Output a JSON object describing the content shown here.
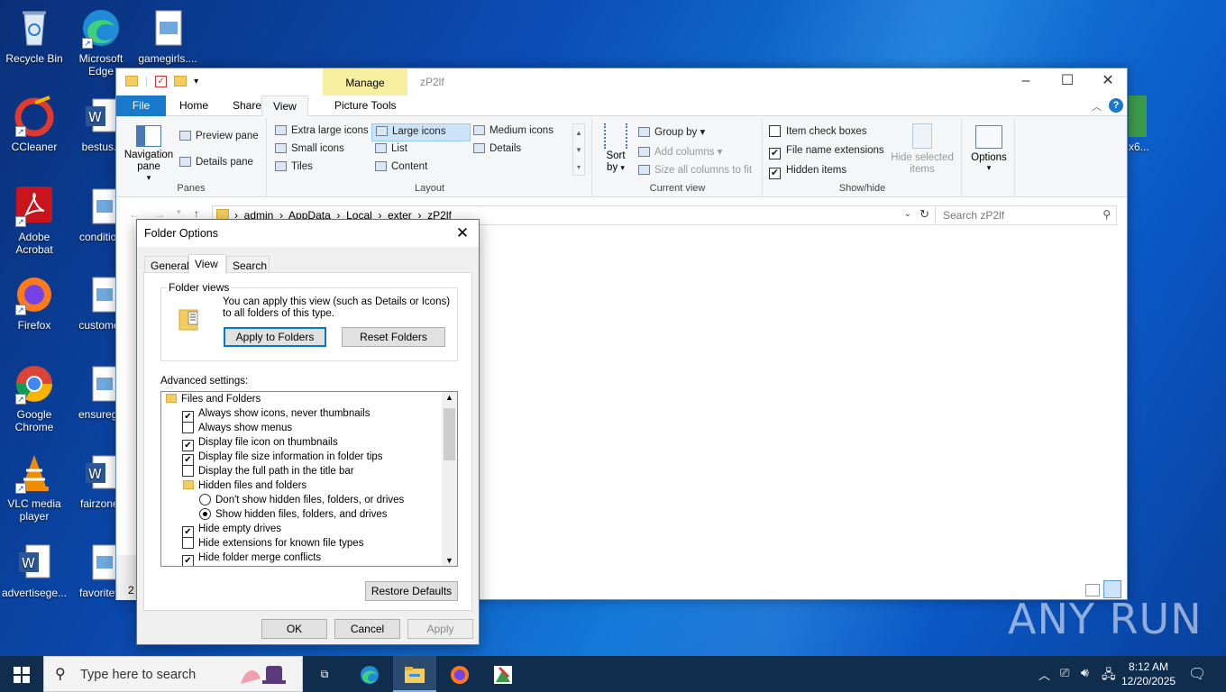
{
  "desktop": {
    "icons": [
      {
        "label": "Recycle Bin"
      },
      {
        "label": "Microsoft Edge"
      },
      {
        "label": "gamegirls...."
      },
      {
        "label": "CCleaner"
      },
      {
        "label": "bestus.r"
      },
      {
        "label": "Adobe Acrobat"
      },
      {
        "label": "condition"
      },
      {
        "label": "Firefox"
      },
      {
        "label": "customer"
      },
      {
        "label": "Google Chrome"
      },
      {
        "label": "ensuregu"
      },
      {
        "label": "VLC media player"
      },
      {
        "label": "fairzone."
      },
      {
        "label": "advertisege..."
      },
      {
        "label": "favoritew"
      }
    ],
    "partial_icon_label": "x6..."
  },
  "explorer": {
    "title": "zP2lf",
    "manage_tab": "Manage",
    "ribbon_tabs": [
      "File",
      "Home",
      "Share",
      "View",
      "Picture Tools"
    ],
    "panes": {
      "navigation_pane": "Navigation pane",
      "preview_pane": "Preview pane",
      "details_pane": "Details pane",
      "label": "Panes"
    },
    "layout": {
      "items": [
        "Extra large icons",
        "Large icons",
        "Medium icons",
        "Small icons",
        "List",
        "Details",
        "Tiles",
        "Content"
      ],
      "label": "Layout"
    },
    "current_view": {
      "sort_by": "Sort by",
      "group_by": "Group by",
      "add_columns": "Add columns",
      "size_columns": "Size all columns to fit",
      "label": "Current view"
    },
    "show_hide": {
      "item_check_boxes": "Item check boxes",
      "file_name_extensions": "File name extensions",
      "hidden_items": "Hidden items",
      "hide_selected": "Hide selected items",
      "label": "Show/hide"
    },
    "options": "Options",
    "address_path": [
      "admin",
      "AppData",
      "Local",
      "exter",
      "zP2lf"
    ],
    "search_placeholder": "Search zP2lf",
    "status_count": "2"
  },
  "dialog": {
    "title": "Folder Options",
    "tabs": [
      "General",
      "View",
      "Search"
    ],
    "folder_views_legend": "Folder views",
    "folder_views_text": "You can apply this view (such as Details or Icons) to all folders of this type.",
    "apply_to_folders": "Apply to Folders",
    "reset_folders": "Reset Folders",
    "advanced_label": "Advanced settings:",
    "tree": [
      {
        "type": "folder",
        "label": "Files and Folders"
      },
      {
        "type": "check",
        "checked": true,
        "label": "Always show icons, never thumbnails"
      },
      {
        "type": "check",
        "checked": false,
        "label": "Always show menus"
      },
      {
        "type": "check",
        "checked": true,
        "label": "Display file icon on thumbnails"
      },
      {
        "type": "check",
        "checked": true,
        "label": "Display file size information in folder tips"
      },
      {
        "type": "check",
        "checked": false,
        "label": "Display the full path in the title bar"
      },
      {
        "type": "folder",
        "label": "Hidden files and folders"
      },
      {
        "type": "radio",
        "checked": false,
        "label": "Don't show hidden files, folders, or drives"
      },
      {
        "type": "radio",
        "checked": true,
        "label": "Show hidden files, folders, and drives"
      },
      {
        "type": "check",
        "checked": true,
        "label": "Hide empty drives"
      },
      {
        "type": "check",
        "checked": false,
        "label": "Hide extensions for known file types"
      },
      {
        "type": "check",
        "checked": true,
        "label": "Hide folder merge conflicts"
      }
    ],
    "restore_defaults": "Restore Defaults",
    "ok": "OK",
    "cancel": "Cancel",
    "apply": "Apply"
  },
  "taskbar": {
    "search_placeholder": "Type here to search",
    "time": "8:12 AM",
    "date": "12/20/2025"
  },
  "watermark": "ANY RUN"
}
